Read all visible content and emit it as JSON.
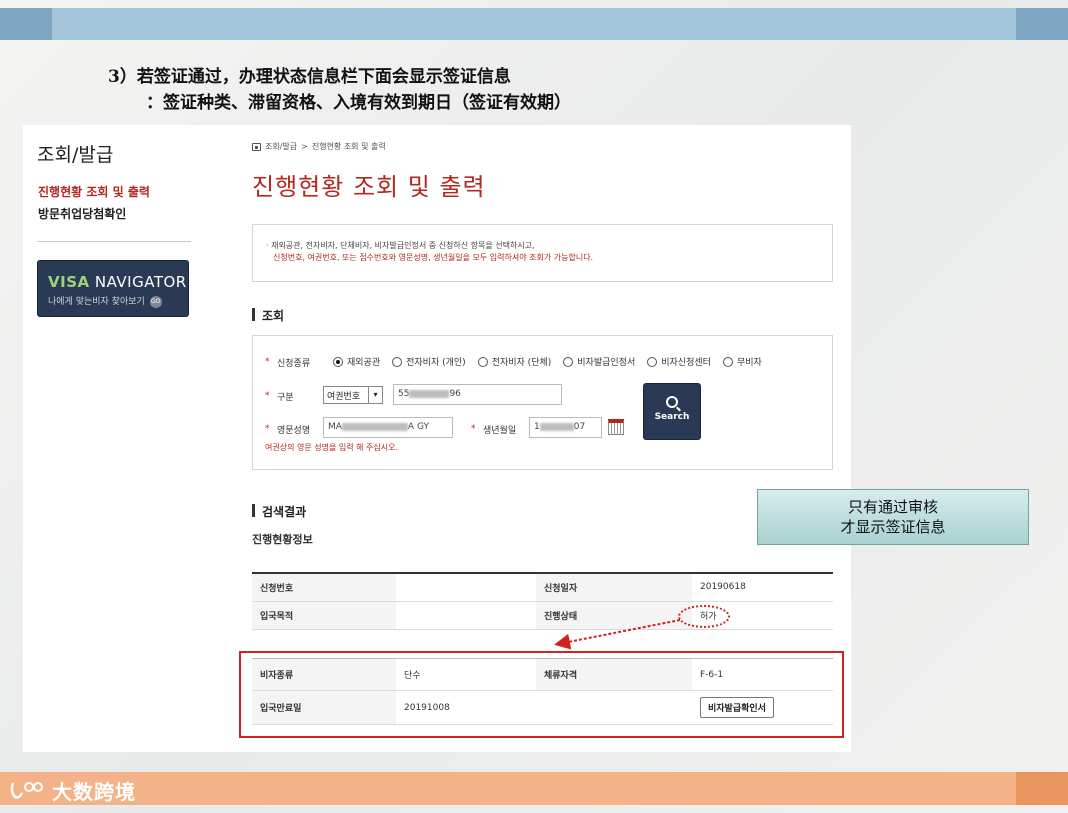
{
  "slide": {
    "heading_line1": "3）若签证通过，办理状态信息栏下面会显示签证信息",
    "heading_line2": "：签证种类、滞留资格、入境有效到期日（签证有效期）",
    "callout_line1": "只有通过审核",
    "callout_line2": "才显示签证信息",
    "logo_text": "大数跨境"
  },
  "sidebar": {
    "title": "조회/발급",
    "items": [
      {
        "label": "진행현황 조회 및 출력",
        "active": true
      },
      {
        "label": "방문취업당첨확인",
        "active": false
      }
    ],
    "banner_brand": "VISA",
    "banner_title": "NAVIGATOR",
    "banner_sub": "나에게 맞는비자 찾아보기",
    "banner_go": "GO"
  },
  "breadcrumb": {
    "item1": "조회/발급",
    "sep": ">",
    "item2": "진행현황 조회 및 출력"
  },
  "page_title": "진행현황 조회 및 출력",
  "notice": {
    "line1": "· 재외공관, 전자비자, 단체비자, 비자발급인정서 중 신청하신 항목을 선택하시고,",
    "line2": "신청번호, 여권번호, 또는 접수번호와 영문성명, 생년월일을 모두 입력하셔야 조회가 가능합니다."
  },
  "search_section": {
    "heading": "조회",
    "type_label": "신청종류",
    "types": [
      {
        "label": "재외공관",
        "selected": true
      },
      {
        "label": "전자비자 (개인)",
        "selected": false
      },
      {
        "label": "전자비자 (단체)",
        "selected": false
      },
      {
        "label": "비자발급인정서",
        "selected": false
      },
      {
        "label": "비자신청센터",
        "selected": false
      },
      {
        "label": "무비자",
        "selected": false
      }
    ],
    "category_label": "구분",
    "category_value": "여권번호",
    "passport_prefix": "55",
    "passport_suffix": "96",
    "name_label": "영문성명",
    "name_prefix": "MA",
    "name_suffix": "A GY",
    "dob_label": "생년월일",
    "dob_prefix": "1",
    "dob_suffix": "07",
    "search_button": "Search",
    "hint": "여권상의 영문 성명을 입력 해 주십시오."
  },
  "results": {
    "heading": "검색결과",
    "subheading": "진행현황정보",
    "rows_top": [
      {
        "k1": "신청번호",
        "v1": "",
        "k2": "신청일자",
        "v2": "20190618"
      },
      {
        "k1": "입국목적",
        "v1": "",
        "k2": "진행상태",
        "v2": "허가"
      }
    ],
    "rows_visa": [
      {
        "k1": "비자종류",
        "v1": "단수",
        "k2": "체류자격",
        "v2": "F-6-1"
      },
      {
        "k1": "입국만료일",
        "v1": "20191008",
        "k2": "",
        "v2": ""
      }
    ],
    "confirm_button": "비자발급확인서"
  },
  "colors": {
    "accent_red": "#b5271f",
    "navy": "#2a3a55",
    "highlight": "#d32020"
  }
}
